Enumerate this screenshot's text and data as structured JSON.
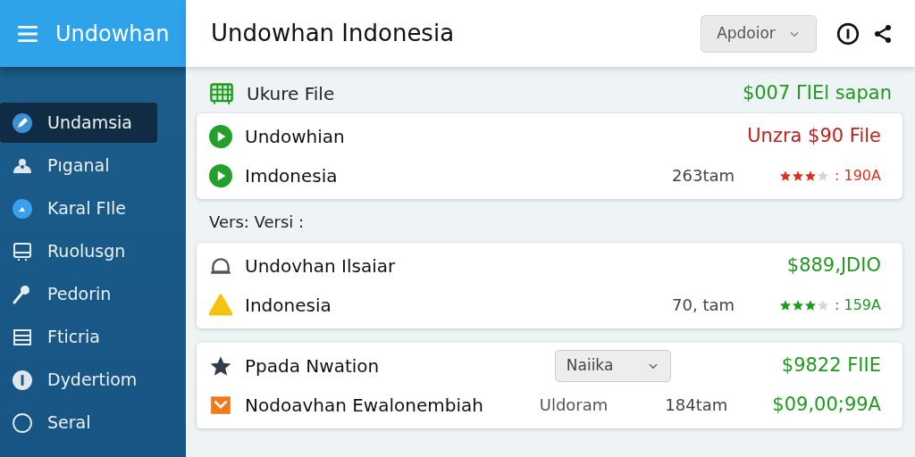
{
  "sidebar": {
    "title": "Undowhan",
    "items": [
      {
        "label": "Undamsia",
        "selected": true
      },
      {
        "label": "Pıganal",
        "selected": false
      },
      {
        "label": "Karal FIle",
        "selected": false
      },
      {
        "label": "Ruolusgn",
        "selected": false
      },
      {
        "label": "Pedorin",
        "selected": false
      },
      {
        "label": "Fticria",
        "selected": false
      },
      {
        "label": "Dydertiom",
        "selected": false
      },
      {
        "label": "Seral",
        "selected": false
      }
    ]
  },
  "header": {
    "title": "Undowhan Indonesia",
    "dropdown": "Apdoior"
  },
  "summary": {
    "label": "Ukure File",
    "amount": "$007 ΓIEl sapan",
    "color": "#1f9a1f"
  },
  "cards": [
    {
      "rows": [
        {
          "title": "Undowhian",
          "amount": "Unzra $90 File",
          "color": "#c0201e"
        },
        {
          "title": "Imdonesia",
          "meta": "263tam",
          "stars": 3,
          "color": "#d8341c",
          "rating": ": 190A"
        }
      ]
    },
    {
      "section": "Vers: Versi :",
      "rows": [
        {
          "title": "Undovhan Ilsaiar",
          "amount": "$889,JDIO",
          "color": "#1f9a1f"
        },
        {
          "title": "Indonesia",
          "meta": "70, tam",
          "stars": 3,
          "color": "#1f9a1f",
          "rating": ": 159A"
        }
      ]
    },
    {
      "rows": [
        {
          "title": "Ppada Nwation",
          "select": "Naiika",
          "amount": "$9822 FIIE",
          "color": "#1f9a1f"
        },
        {
          "title": "Nodoavhan Ewalonembiah",
          "sub": "Uldoram",
          "meta": "184tam",
          "amount": "$09,00;99A",
          "color": "#1f9a1f"
        }
      ]
    }
  ]
}
